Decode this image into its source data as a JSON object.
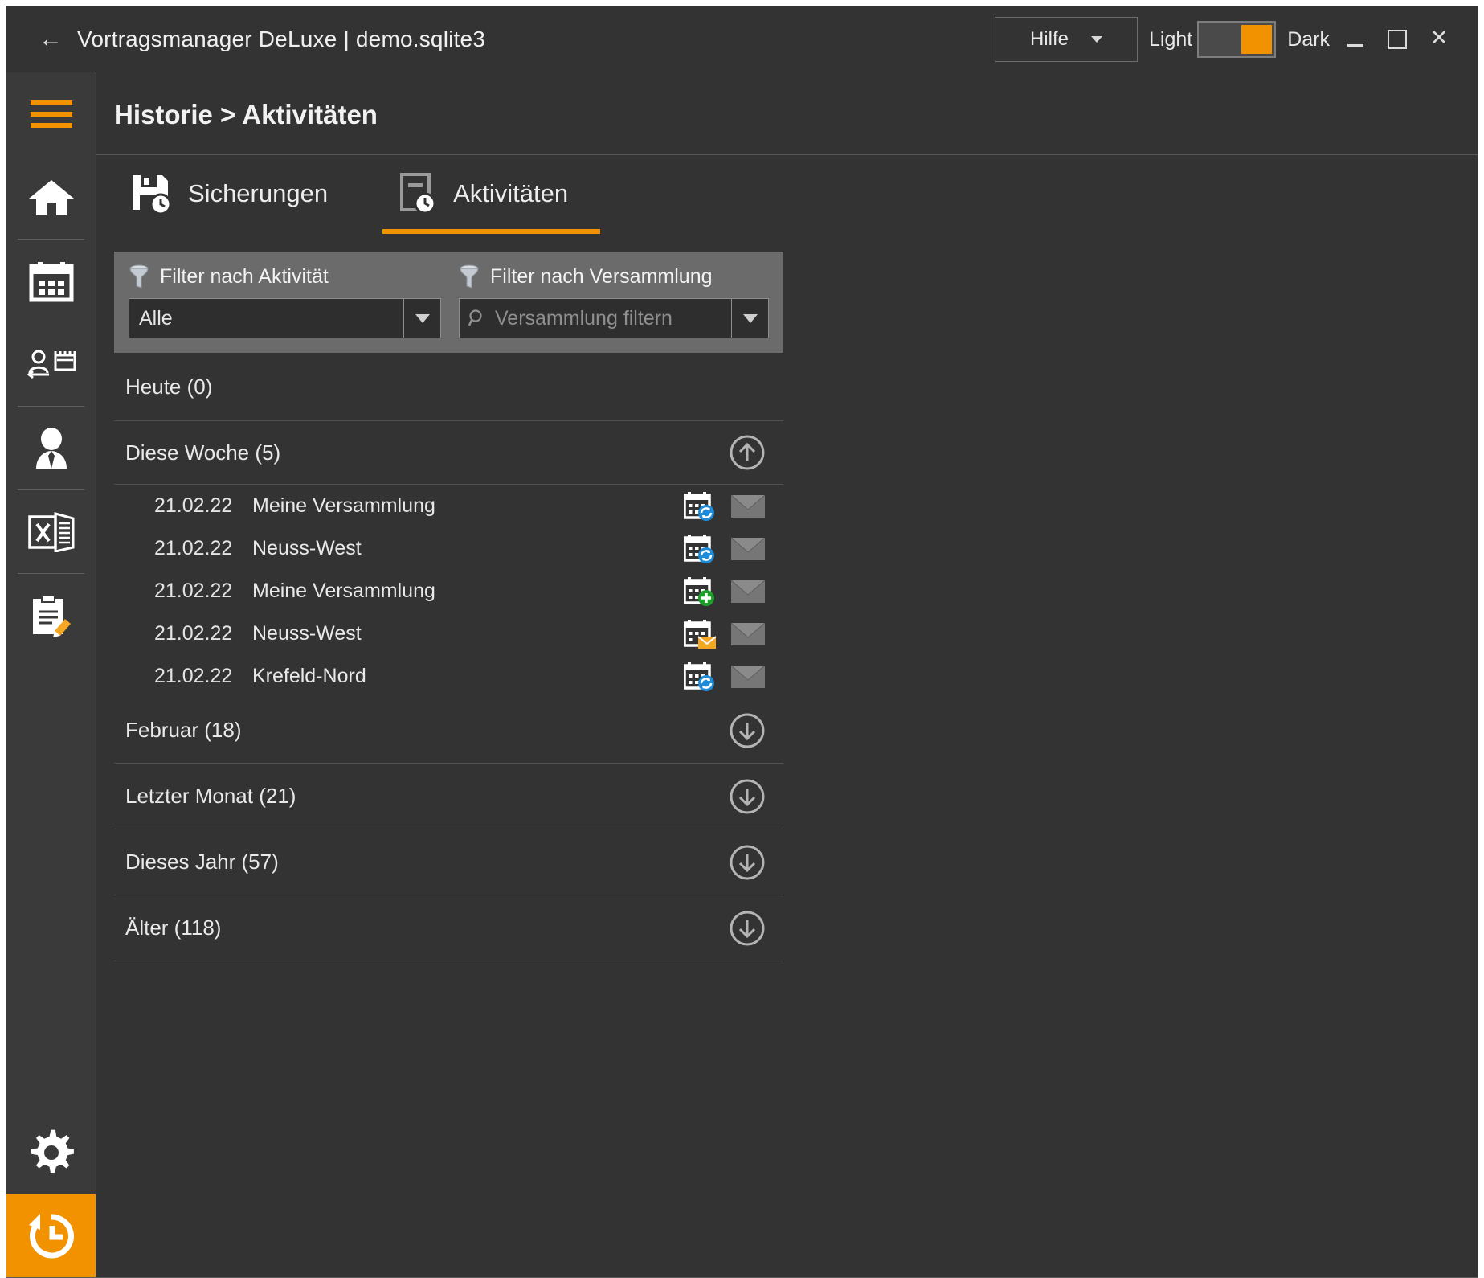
{
  "titlebar": {
    "back_icon": "back-arrow-icon",
    "title": "Vortragsmanager DeLuxe | demo.sqlite3",
    "help_label": "Hilfe",
    "theme_light_label": "Light",
    "theme_dark_label": "Dark",
    "theme_state": "dark",
    "minimize_label": "",
    "maximize_label": "",
    "close_label": "✕"
  },
  "sidebar": {
    "menu_icon": "hamburger-menu-icon",
    "items": [
      {
        "name": "home",
        "icon": "home-icon"
      },
      {
        "name": "calendar",
        "icon": "calendar-icon"
      },
      {
        "name": "speaker-exchange",
        "icon": "speaker-exchange-icon"
      },
      {
        "name": "speaker",
        "icon": "person-suit-icon"
      },
      {
        "name": "excel-export",
        "icon": "excel-icon"
      },
      {
        "name": "notes",
        "icon": "clipboard-edit-icon"
      }
    ],
    "bottom_items": [
      {
        "name": "settings",
        "icon": "gear-icon",
        "active": false
      },
      {
        "name": "history",
        "icon": "history-clock-icon",
        "active": true
      }
    ]
  },
  "header": {
    "breadcrumb": "Historie > Aktivitäten"
  },
  "tabs": [
    {
      "label": "Sicherungen",
      "icon": "floppy-clock-icon",
      "active": false
    },
    {
      "label": "Aktivitäten",
      "icon": "document-clock-icon",
      "active": true
    }
  ],
  "filters": {
    "activity": {
      "icon": "funnel-icon",
      "label": "Filter nach Aktivität",
      "value": "Alle",
      "options": [
        "Alle"
      ]
    },
    "assembly": {
      "icon": "funnel-icon",
      "search_icon": "magnifier-icon",
      "label": "Filter nach Versammlung",
      "value": "",
      "placeholder": "Versammlung filtern"
    }
  },
  "groups": [
    {
      "label": "Heute (0)",
      "expanded": false,
      "toggle_icon": "",
      "items": []
    },
    {
      "label": "Diese Woche (5)",
      "expanded": true,
      "toggle_icon": "arrow-up-circle-icon",
      "items": [
        {
          "date": "21.02.22",
          "name": "Meine Versammlung",
          "badge": "sync",
          "mail_icon": "envelope-icon"
        },
        {
          "date": "21.02.22",
          "name": "Neuss-West",
          "badge": "sync",
          "mail_icon": "envelope-icon"
        },
        {
          "date": "21.02.22",
          "name": "Meine Versammlung",
          "badge": "plus",
          "mail_icon": "envelope-icon"
        },
        {
          "date": "21.02.22",
          "name": "Neuss-West",
          "badge": "mail",
          "mail_icon": "envelope-icon"
        },
        {
          "date": "21.02.22",
          "name": "Krefeld-Nord",
          "badge": "sync",
          "mail_icon": "envelope-icon"
        }
      ]
    },
    {
      "label": "Februar (18)",
      "expanded": false,
      "toggle_icon": "arrow-down-circle-icon",
      "items": []
    },
    {
      "label": "Letzter Monat (21)",
      "expanded": false,
      "toggle_icon": "arrow-down-circle-icon",
      "items": []
    },
    {
      "label": "Dieses Jahr (57)",
      "expanded": false,
      "toggle_icon": "arrow-down-circle-icon",
      "items": []
    },
    {
      "label": "Älter (118)",
      "expanded": false,
      "toggle_icon": "arrow-down-circle-icon",
      "items": []
    }
  ],
  "colors": {
    "accent": "#f39200",
    "window_bg": "#333333",
    "sidebar_bg": "#3a3a3a",
    "panel_bg": "#6b6b6b",
    "text": "#e9e9e9",
    "badge_sync": "#1d8bd8",
    "badge_plus": "#1ba02c",
    "badge_mail": "#f5a623"
  }
}
